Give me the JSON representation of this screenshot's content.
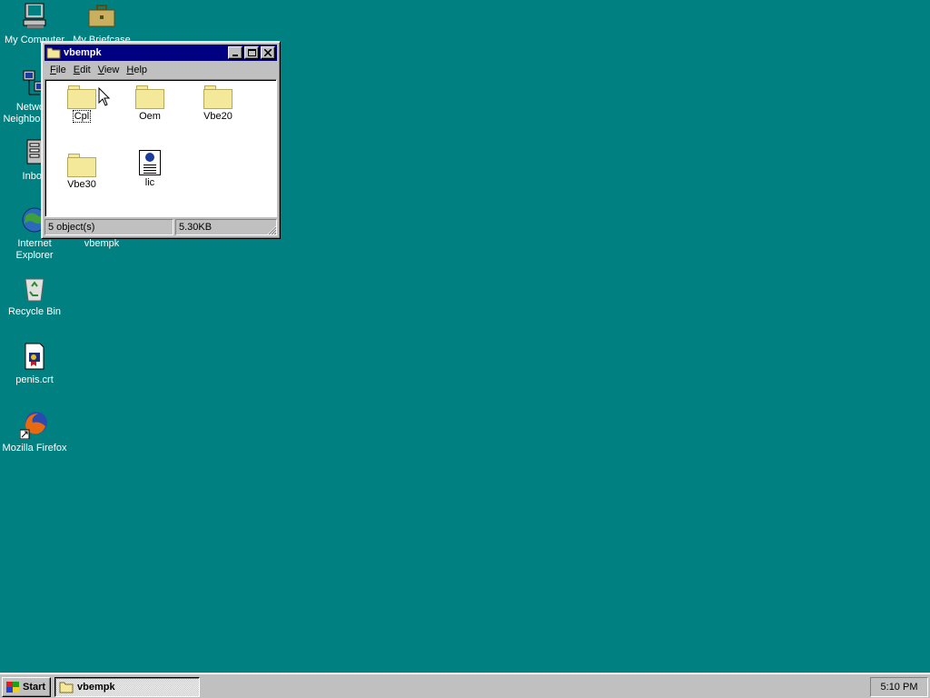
{
  "desktop": {
    "icons": [
      {
        "label": "My Computer",
        "icon": "my-computer-icon"
      },
      {
        "label": "My Briefcase",
        "icon": "briefcase-icon"
      },
      {
        "label": "Network Neighborhood",
        "line1": "Network",
        "line2": "Neighborhood",
        "icon": "network-neighborhood-icon"
      },
      {
        "label": "Inbox",
        "icon": "inbox-icon"
      },
      {
        "label": "Internet Explorer",
        "line1": "Internet",
        "line2": "Explorer",
        "icon": "internet-explorer-icon"
      },
      {
        "label": "vbempk",
        "icon": "folder-icon"
      },
      {
        "label": "Recycle Bin",
        "icon": "recycle-bin-icon"
      },
      {
        "label": "penis.crt",
        "icon": "certificate-file-icon"
      },
      {
        "label": "Mozilla Firefox",
        "icon": "firefox-icon"
      }
    ]
  },
  "window": {
    "title": "vbempk",
    "menu": [
      {
        "label": "File",
        "key": "F",
        "rest": "ile"
      },
      {
        "label": "Edit",
        "key": "E",
        "rest": "dit"
      },
      {
        "label": "View",
        "key": "V",
        "rest": "iew"
      },
      {
        "label": "Help",
        "key": "H",
        "rest": "elp"
      }
    ],
    "items": [
      {
        "label": "Cpl",
        "type": "folder"
      },
      {
        "label": "Oem",
        "type": "folder"
      },
      {
        "label": "Vbe20",
        "type": "folder"
      },
      {
        "label": "Vbe30",
        "type": "folder"
      },
      {
        "label": "lic",
        "type": "document"
      }
    ],
    "status": {
      "objects": "5 object(s)",
      "size": "5.30KB"
    }
  },
  "taskbar": {
    "start_label": "Start",
    "task_label": "vbempk",
    "clock": "5:10 PM"
  },
  "colors": {
    "desktop": "#008080",
    "titlebar": "#000080",
    "face": "#c0c0c0"
  }
}
